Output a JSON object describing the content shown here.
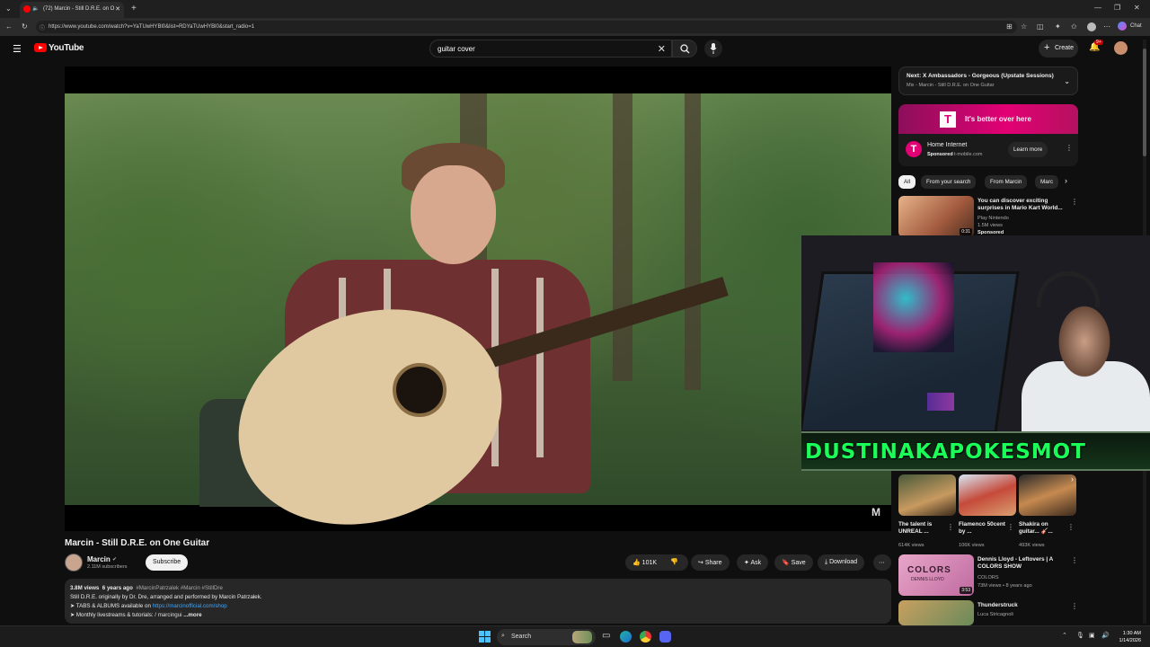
{
  "browser": {
    "tab_title": "(72) Marcin - Still D.R.E. on O",
    "url": "https://www.youtube.com/watch?v=YaTUwHYBl0&list=RDYaTUwHYBl0&start_radio=1",
    "chat_label": "Chat"
  },
  "header": {
    "logo_text": "YouTube",
    "search_value": "guitar cover",
    "create_label": "Create",
    "notifications_badge": "9+"
  },
  "video": {
    "title": "Marcin - Still D.R.E. on One Guitar",
    "watermark": "M",
    "channel_name": "Marcin",
    "subscribers": "2.11M subscribers",
    "subscribe_label": "Subscribe",
    "likes": "101K",
    "share_label": "Share",
    "ask_label": "Ask",
    "save_label": "Save",
    "download_label": "Download",
    "desc_views": "3.8M views",
    "desc_age": "6 years ago",
    "desc_tags": "#MarcinPatrzalek #Marcin #StillDre",
    "desc_line1": "Still D.R.E. originally by Dr. Dre, arranged and performed by Marcin Patrzałek.",
    "desc_line2_prefix": "➤ TABS & ALBUMS available on",
    "desc_line2_link": "https://marcinofficial.com/shop",
    "desc_line3": "➤ Monthly livestreams & tutorials: ",
    "desc_line3_handle": "/ marcingui",
    "desc_more": "...more"
  },
  "sidebar": {
    "next_title": "Next: X Ambassadors - Gorgeous (Upstate Sessions)",
    "next_sub": "Mix - Marcin - Still D.R.E. on One Guitar",
    "ad": {
      "banner_text": "It's better over here",
      "title": "Home Internet",
      "sponsored": "Sponsored",
      "domain": "t-mobile.com",
      "cta": "Learn more"
    },
    "chips": [
      "All",
      "From your search",
      "From Marcin",
      "Marc"
    ],
    "rec1": {
      "title": "You can discover exciting surprises in Mario Kart World...",
      "channel": "Play Nintendo",
      "views": "1.5M views",
      "badge": "Sponsored",
      "duration": "0:31"
    },
    "shorts": [
      {
        "title": "The talent is UNREAL ...",
        "views": "614K views"
      },
      {
        "title": "Flamenco 50cent by ...",
        "views": "106K views"
      },
      {
        "title": "Shakira on guitar... 🎸...",
        "views": "493K views"
      }
    ],
    "rec2": {
      "title": "Dennis Lloyd - Leftovers | A COLORS SHOW",
      "channel": "COLORS",
      "meta": "73M views • 8 years ago",
      "duration": "3:53",
      "thumb_text": "COLORS",
      "thumb_sub": "DENNIS LLOYD"
    },
    "rec3": {
      "title": "Thunderstruck",
      "channel": "Luca Stricagnoli"
    }
  },
  "overlay": {
    "banner_text": "DUSTINAKAPOKESMOT"
  },
  "taskbar": {
    "search_label": "Search",
    "time": "1:30 AM",
    "date": "1/14/2026"
  },
  "colors": {
    "accent_red": "#ff0000",
    "link_blue": "#3ea6ff",
    "tmobile_magenta": "#e20074",
    "overlay_green": "#1aff58"
  }
}
